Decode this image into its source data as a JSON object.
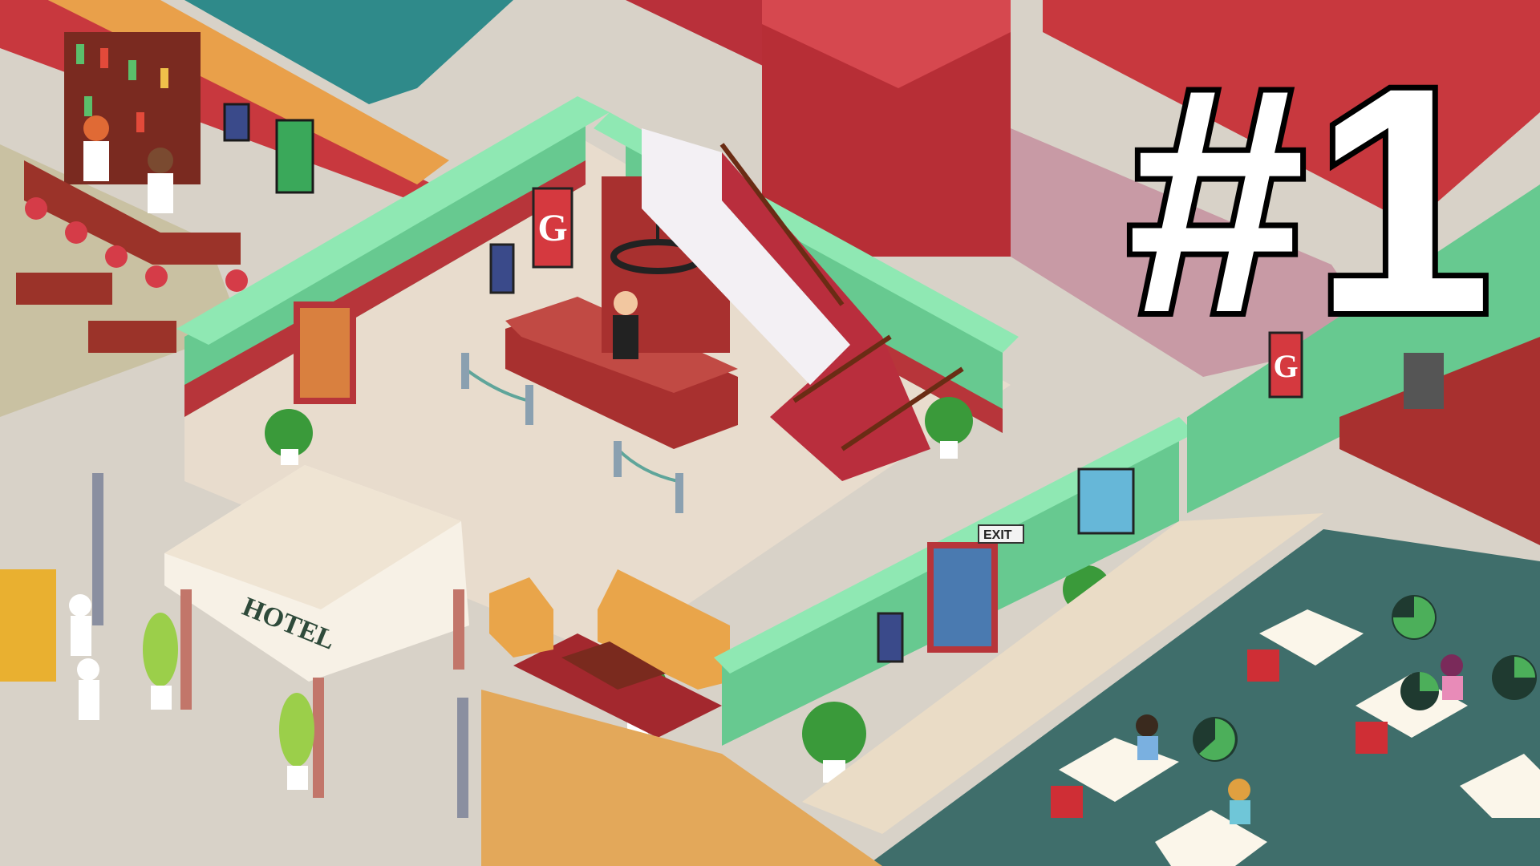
{
  "episode_title": "#1",
  "signs": {
    "hotel": "HOTEL",
    "exit": "EXIT",
    "logo_glyph": "G"
  },
  "palette": {
    "wall_red": "#c8383e",
    "wall_green": "#6fd49a",
    "floor_lobby": "#e8dccd",
    "floor_restaurant": "#3f6e6b",
    "carpet_red": "#b32b34",
    "wood": "#8a2e24",
    "sofa": "#e9a54a",
    "street": "#d8d4cc"
  },
  "icons": [
    "timer-icon",
    "timer-icon",
    "timer-icon",
    "timer-icon",
    "exit-sign-icon",
    "chandelier-icon"
  ]
}
